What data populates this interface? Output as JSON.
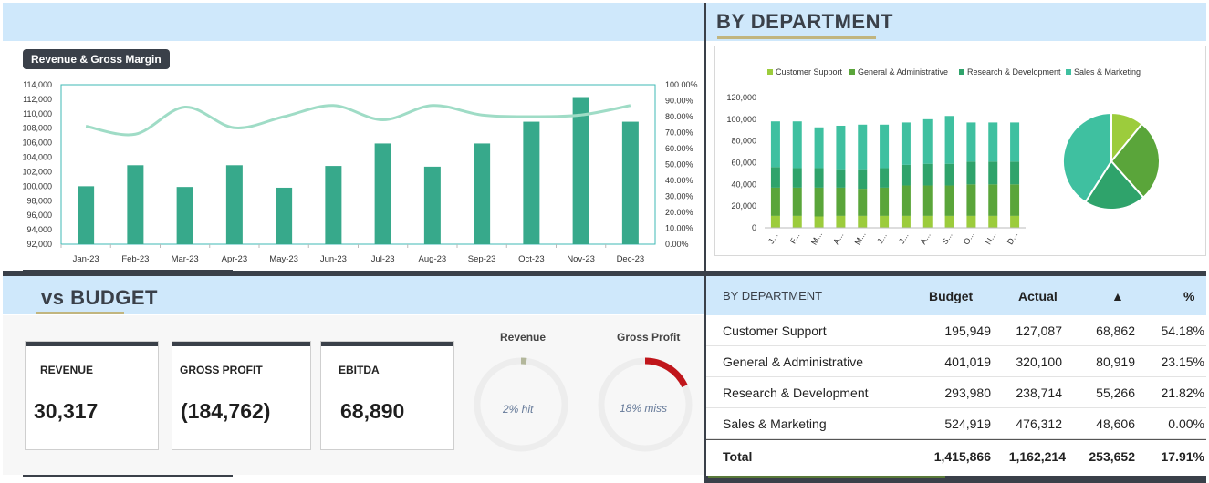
{
  "revenue_chart": {
    "title": "Revenue & Gross Margin",
    "chart_data": {
      "type": "bar",
      "categories": [
        "Jan-23",
        "Feb-23",
        "Mar-23",
        "Apr-23",
        "May-23",
        "Jun-23",
        "Jul-23",
        "Aug-23",
        "Sep-23",
        "Oct-23",
        "Nov-23",
        "Dec-23"
      ],
      "series": [
        {
          "values": [
            100000,
            102900,
            99900,
            102900,
            99800,
            102800,
            105900,
            102700,
            105900,
            108900,
            112300,
            108900
          ],
          "axis": "left",
          "type": "bar"
        },
        {
          "values": [
            74,
            69,
            86,
            73,
            80,
            87,
            78,
            87,
            81,
            80,
            81,
            87
          ],
          "axis": "right",
          "type": "line"
        }
      ],
      "ylim": [
        92000,
        114000
      ],
      "y2lim": [
        0,
        100
      ],
      "yticks": [
        "92,000",
        "94,000",
        "96,000",
        "98,000",
        "100,000",
        "102,000",
        "104,000",
        "106,000",
        "108,000",
        "110,000",
        "112,000",
        "114,000"
      ],
      "y2ticks": [
        "0.00%",
        "10.00%",
        "20.00%",
        "30.00%",
        "40.00%",
        "50.00%",
        "60.00%",
        "70.00%",
        "80.00%",
        "90.00%",
        "100.00%"
      ],
      "colors": {
        "bar": "#37a98b",
        "line": "#9fdcc6"
      },
      "grid": false
    }
  },
  "by_department": {
    "title": "BY DEPARTMENT",
    "chart_data": [
      {
        "type": "bar",
        "stacked": true,
        "categories": [
          "J...",
          "F...",
          "M...",
          "A...",
          "M...",
          "J...",
          "J...",
          "A...",
          "S...",
          "O...",
          "N...",
          "D..."
        ],
        "series": [
          {
            "name": "Customer Support",
            "values": [
              11000,
              11000,
              10500,
              11000,
              11000,
              11000,
              11000,
              11000,
              11000,
              11000,
              11000,
              11000
            ],
            "color": "#9ccc3c"
          },
          {
            "name": "General & Administrative",
            "values": [
              26000,
              26000,
              26500,
              26000,
              25000,
              26000,
              28000,
              28000,
              28000,
              29000,
              29000,
              29000
            ],
            "color": "#5aa53a"
          },
          {
            "name": "Research & Development",
            "values": [
              19000,
              18000,
              18000,
              17000,
              18000,
              18000,
              19000,
              20000,
              20000,
              21000,
              21000,
              21000
            ],
            "color": "#2fa36b"
          },
          {
            "name": "Sales & Marketing",
            "values": [
              42000,
              43000,
              37500,
              40000,
              41000,
              40000,
              39000,
              41000,
              44000,
              36000,
              36000,
              36000
            ],
            "color": "#3fc0a0"
          }
        ],
        "yticks": [
          "0",
          "20,000",
          "40,000",
          "60,000",
          "80,000",
          "100,000",
          "120,000"
        ],
        "ylim": [
          0,
          120000
        ],
        "legend": "top"
      },
      {
        "type": "pie",
        "labels": [
          "Customer Support",
          "General & Administrative",
          "Research & Development",
          "Sales & Marketing"
        ],
        "values": [
          127087,
          320100,
          238714,
          476312
        ],
        "colors": [
          "#9ccc3c",
          "#5aa53a",
          "#2fa36b",
          "#3fc0a0"
        ]
      }
    ]
  },
  "vs_budget": {
    "title": "vs BUDGET",
    "cards": [
      {
        "label": "REVENUE",
        "value": "30,317"
      },
      {
        "label": "GROSS PROFIT",
        "value": "(184,762)"
      },
      {
        "label": "EBITDA",
        "value": "68,890"
      }
    ],
    "gauges": [
      {
        "title": "Revenue",
        "text": "2% hit",
        "percent": 2,
        "color": "#b3b79b"
      },
      {
        "title": "Gross Profit",
        "text": "18% miss",
        "percent": 18,
        "color": "#c0161b"
      }
    ]
  },
  "dept_table": {
    "headers": [
      "BY DEPARTMENT",
      "Budget",
      "Actual",
      "▲",
      "%"
    ],
    "rows": [
      [
        "Customer Support",
        "195,949",
        "127,087",
        "68,862",
        "54.18%"
      ],
      [
        "General & Administrative",
        "401,019",
        "320,100",
        "80,919",
        "23.15%"
      ],
      [
        "Research & Development",
        "293,980",
        "238,714",
        "55,266",
        "21.82%"
      ],
      [
        "Sales & Marketing",
        "524,919",
        "476,312",
        "48,606",
        "0.00%"
      ]
    ],
    "total": [
      "Total",
      "1,415,866",
      "1,162,214",
      "253,652",
      "17.91%"
    ]
  }
}
